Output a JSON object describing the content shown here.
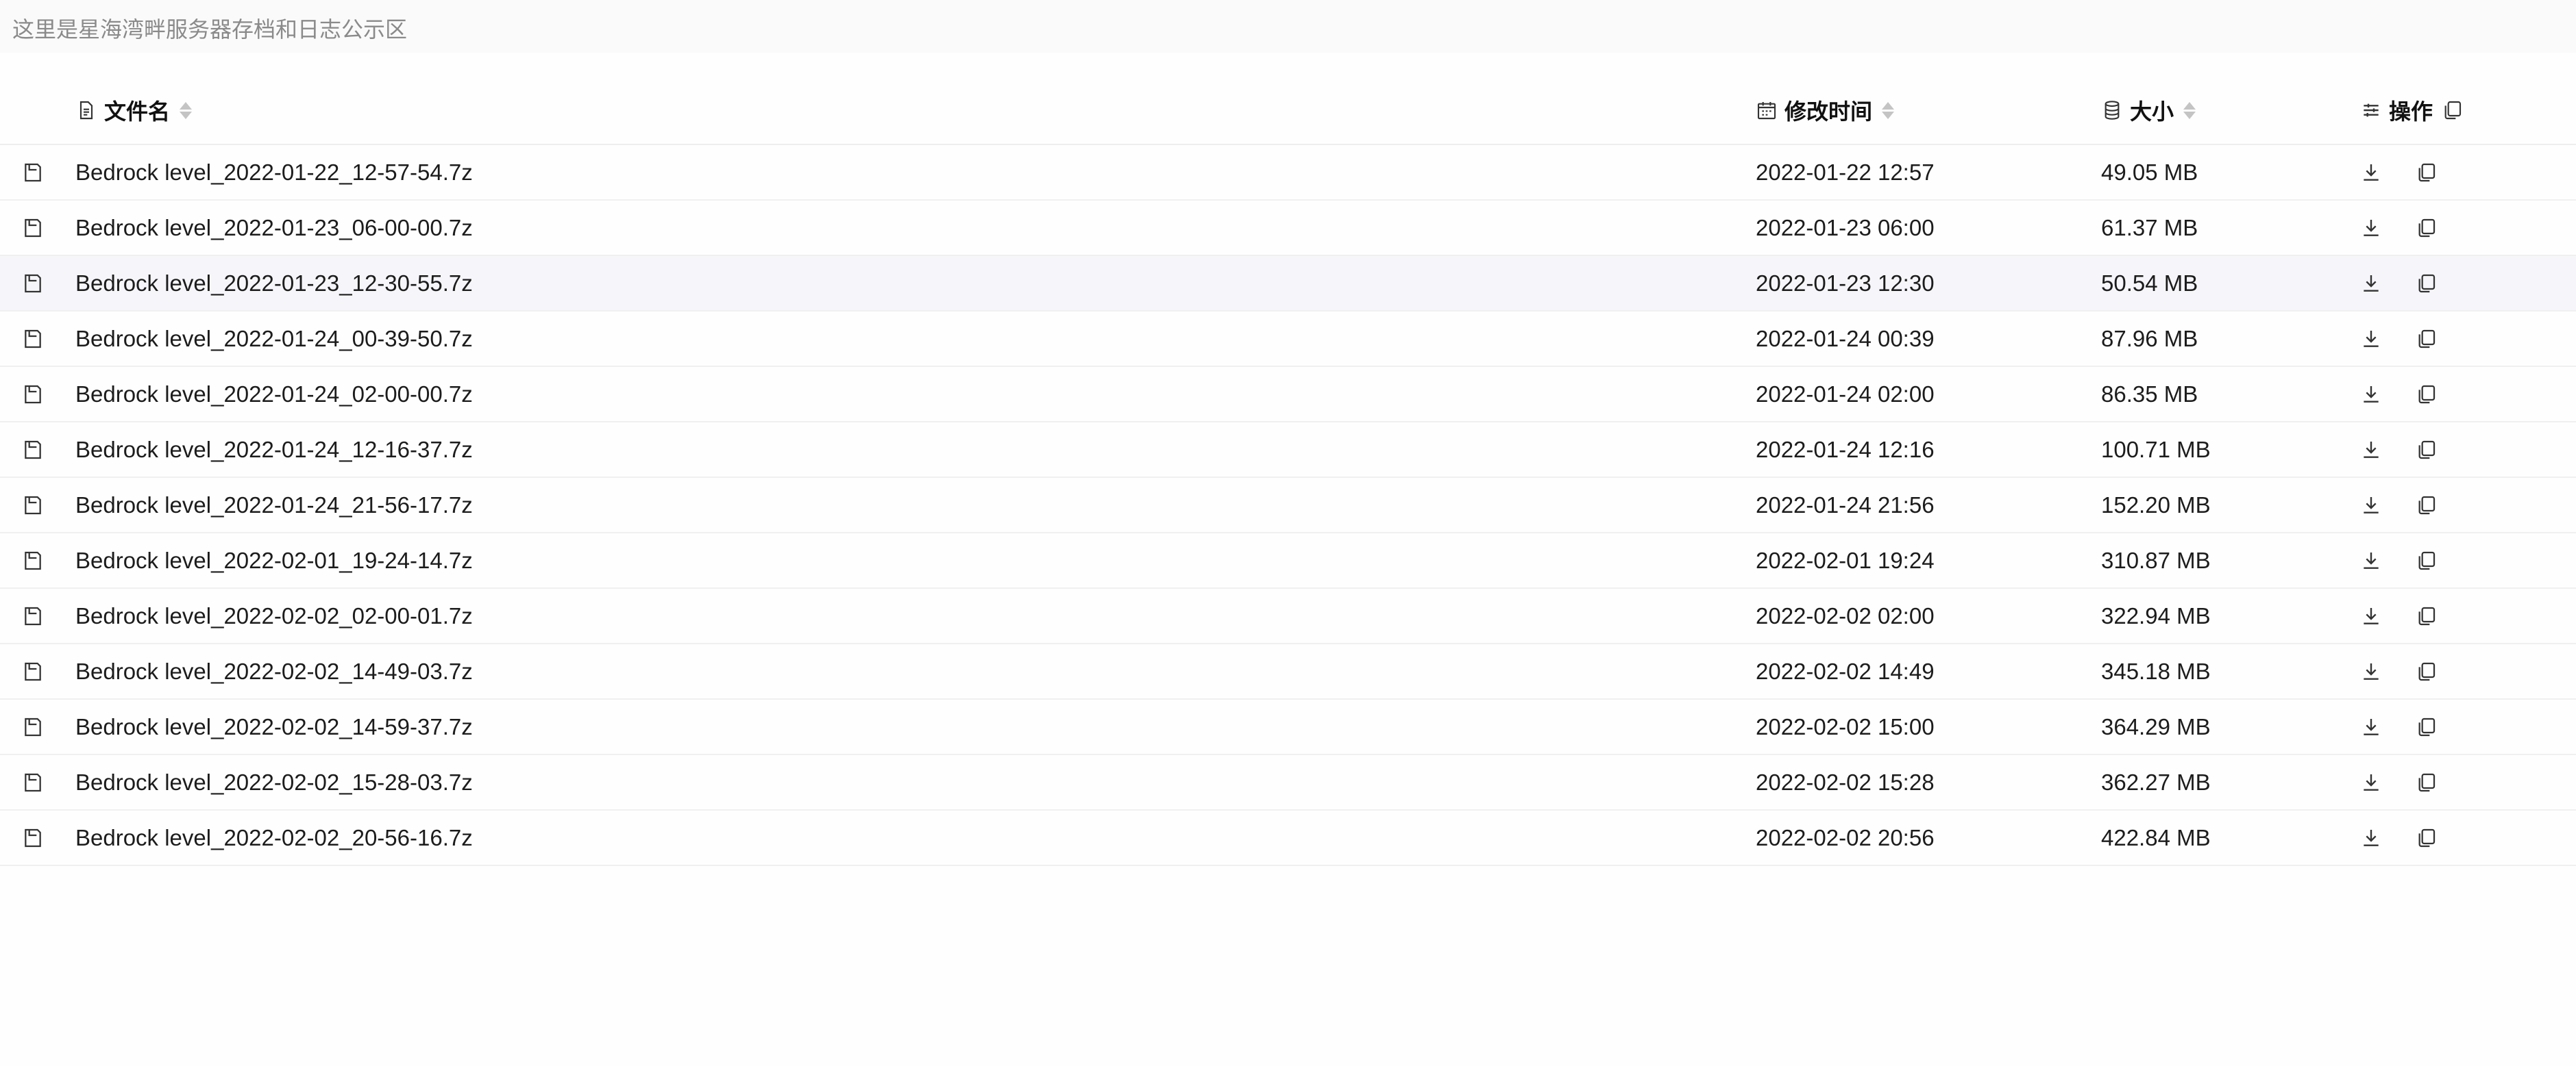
{
  "notice": "这里是星海湾畔服务器存档和日志公示区",
  "header": {
    "name": "文件名",
    "time": "修改时间",
    "size": "大小",
    "actions": "操作"
  },
  "icons": {
    "file": "file-icon",
    "calendar": "calendar-icon",
    "database": "database-icon",
    "settings": "sliders-icon",
    "download": "download-icon",
    "copy": "copy-icon"
  },
  "highlighted_row": 2,
  "rows": [
    {
      "name": "Bedrock level_2022-01-22_12-57-54.7z",
      "time": "2022-01-22 12:57",
      "size": "49.05 MB"
    },
    {
      "name": "Bedrock level_2022-01-23_06-00-00.7z",
      "time": "2022-01-23 06:00",
      "size": "61.37 MB"
    },
    {
      "name": "Bedrock level_2022-01-23_12-30-55.7z",
      "time": "2022-01-23 12:30",
      "size": "50.54 MB"
    },
    {
      "name": "Bedrock level_2022-01-24_00-39-50.7z",
      "time": "2022-01-24 00:39",
      "size": "87.96 MB"
    },
    {
      "name": "Bedrock level_2022-01-24_02-00-00.7z",
      "time": "2022-01-24 02:00",
      "size": "86.35 MB"
    },
    {
      "name": "Bedrock level_2022-01-24_12-16-37.7z",
      "time": "2022-01-24 12:16",
      "size": "100.71 MB"
    },
    {
      "name": "Bedrock level_2022-01-24_21-56-17.7z",
      "time": "2022-01-24 21:56",
      "size": "152.20 MB"
    },
    {
      "name": "Bedrock level_2022-02-01_19-24-14.7z",
      "time": "2022-02-01 19:24",
      "size": "310.87 MB"
    },
    {
      "name": "Bedrock level_2022-02-02_02-00-01.7z",
      "time": "2022-02-02 02:00",
      "size": "322.94 MB"
    },
    {
      "name": "Bedrock level_2022-02-02_14-49-03.7z",
      "time": "2022-02-02 14:49",
      "size": "345.18 MB"
    },
    {
      "name": "Bedrock level_2022-02-02_14-59-37.7z",
      "time": "2022-02-02 15:00",
      "size": "364.29 MB"
    },
    {
      "name": "Bedrock level_2022-02-02_15-28-03.7z",
      "time": "2022-02-02 15:28",
      "size": "362.27 MB"
    },
    {
      "name": "Bedrock level_2022-02-02_20-56-16.7z",
      "time": "2022-02-02 20:56",
      "size": "422.84 MB"
    }
  ]
}
